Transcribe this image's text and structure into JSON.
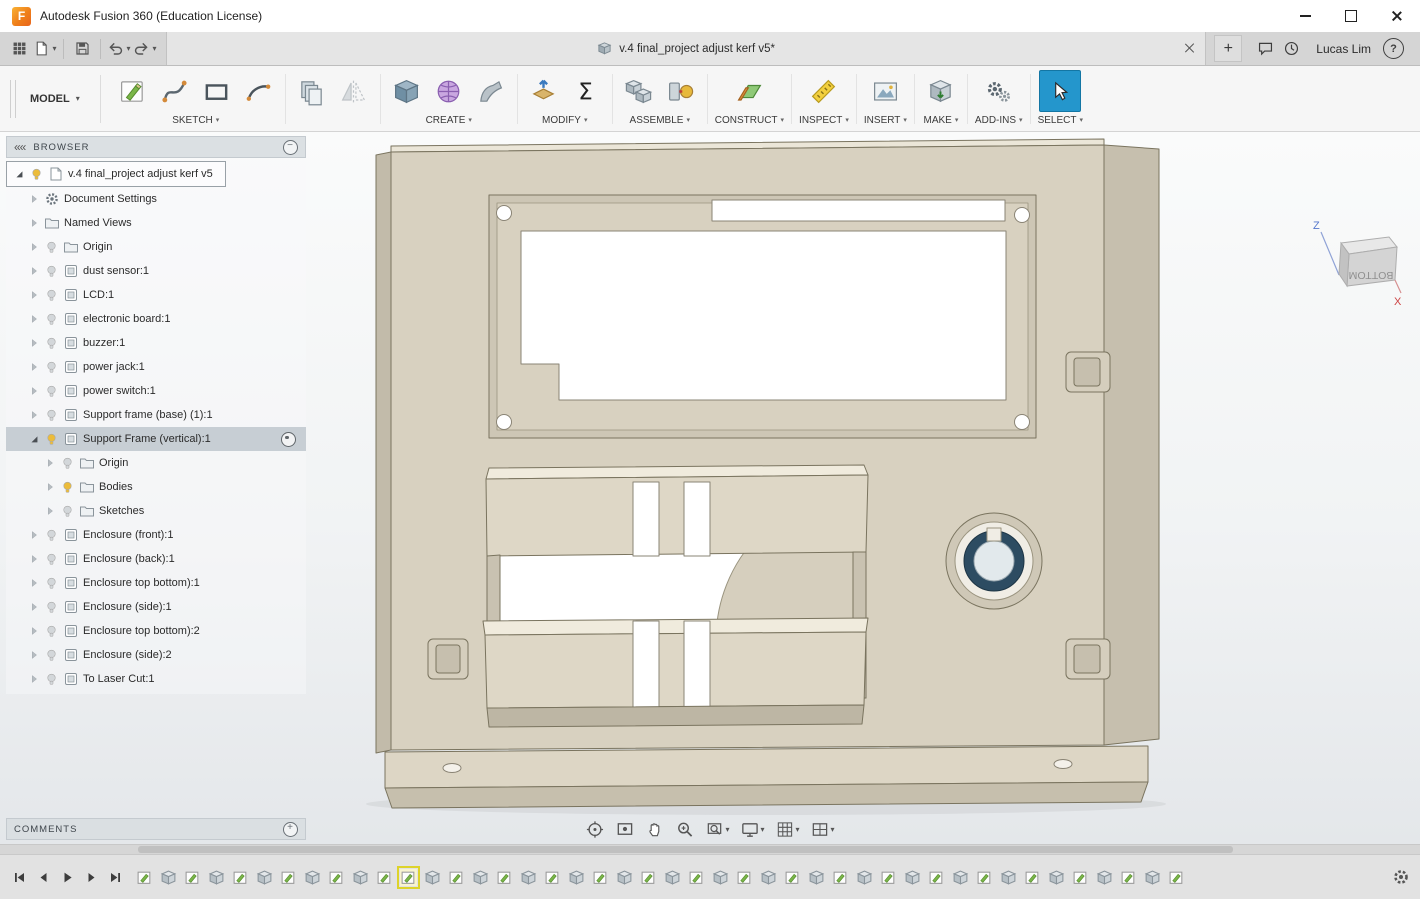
{
  "window": {
    "title": "Autodesk Fusion 360 (Education License)"
  },
  "quick_access": {
    "tab_title": "v.4 final_project adjust kerf v5*",
    "user_name": "Lucas Lim"
  },
  "ribbon": {
    "workspace_label": "MODEL",
    "groups": [
      {
        "label": "SKETCH",
        "icons": [
          "sketch",
          "spline",
          "rectangle",
          "arc"
        ]
      },
      {
        "label": "",
        "icons": [
          "pattern",
          "mirror"
        ]
      },
      {
        "label": "CREATE",
        "icons": [
          "box",
          "form",
          "sweep"
        ]
      },
      {
        "label": "MODIFY",
        "icons": [
          "presspull",
          "sigma"
        ]
      },
      {
        "label": "ASSEMBLE",
        "icons": [
          "assemble",
          "joint"
        ]
      },
      {
        "label": "CONSTRUCT",
        "icons": [
          "plane"
        ]
      },
      {
        "label": "INSPECT",
        "icons": [
          "measure"
        ]
      },
      {
        "label": "INSERT",
        "icons": [
          "canvas"
        ]
      },
      {
        "label": "MAKE",
        "icons": [
          "make"
        ]
      },
      {
        "label": "ADD-INS",
        "icons": [
          "addins"
        ]
      },
      {
        "label": "SELECT",
        "icons": [
          "select"
        ]
      }
    ]
  },
  "viewcube": {
    "face_label": "BOTTOM",
    "axis_z": "Z",
    "axis_x": "X"
  },
  "browser": {
    "header": "BROWSER",
    "rows": [
      {
        "label": "v.4 final_project adjust kerf v5",
        "depth": 0,
        "icon": "document",
        "bulb": "on",
        "arrow": "expanded",
        "root": true
      },
      {
        "label": "Document Settings",
        "depth": 1,
        "icon": "gear",
        "bulb": null,
        "arrow": "collapsed"
      },
      {
        "label": "Named Views",
        "depth": 1,
        "icon": "folder",
        "bulb": null,
        "arrow": "collapsed"
      },
      {
        "label": "Origin",
        "depth": 1,
        "icon": "folder",
        "bulb": "off",
        "arrow": "collapsed"
      },
      {
        "label": "dust sensor:1",
        "depth": 1,
        "icon": "component",
        "bulb": "off",
        "arrow": "collapsed"
      },
      {
        "label": "LCD:1",
        "depth": 1,
        "icon": "component",
        "bulb": "off",
        "arrow": "collapsed"
      },
      {
        "label": "electronic board:1",
        "depth": 1,
        "icon": "component",
        "bulb": "off",
        "arrow": "collapsed"
      },
      {
        "label": "buzzer:1",
        "depth": 1,
        "icon": "component",
        "bulb": "off",
        "arrow": "collapsed"
      },
      {
        "label": "power jack:1",
        "depth": 1,
        "icon": "component",
        "bulb": "off",
        "arrow": "collapsed"
      },
      {
        "label": "power switch:1",
        "depth": 1,
        "icon": "component",
        "bulb": "off",
        "arrow": "collapsed"
      },
      {
        "label": "Support frame (base) (1):1",
        "depth": 1,
        "icon": "component",
        "bulb": "off",
        "arrow": "collapsed"
      },
      {
        "label": "Support Frame (vertical):1",
        "depth": 1,
        "icon": "component",
        "bulb": "on",
        "arrow": "expanded",
        "selected": true,
        "activate": true
      },
      {
        "label": "Origin",
        "depth": 2,
        "icon": "folder",
        "bulb": "off",
        "arrow": "collapsed"
      },
      {
        "label": "Bodies",
        "depth": 2,
        "icon": "folder",
        "bulb": "on",
        "arrow": "collapsed"
      },
      {
        "label": "Sketches",
        "depth": 2,
        "icon": "folder",
        "bulb": "off",
        "arrow": "collapsed"
      },
      {
        "label": "Enclosure (front):1",
        "depth": 1,
        "icon": "component",
        "bulb": "off",
        "arrow": "collapsed"
      },
      {
        "label": "Enclosure (back):1",
        "depth": 1,
        "icon": "component",
        "bulb": "off",
        "arrow": "collapsed"
      },
      {
        "label": "Enclosure top bottom):1",
        "depth": 1,
        "icon": "component",
        "bulb": "off",
        "arrow": "collapsed"
      },
      {
        "label": "Enclosure (side):1",
        "depth": 1,
        "icon": "component",
        "bulb": "off",
        "arrow": "collapsed"
      },
      {
        "label": "Enclosure top bottom):2",
        "depth": 1,
        "icon": "component",
        "bulb": "off",
        "arrow": "collapsed"
      },
      {
        "label": "Enclosure (side):2",
        "depth": 1,
        "icon": "component",
        "bulb": "off",
        "arrow": "collapsed"
      },
      {
        "label": "To Laser Cut:1",
        "depth": 1,
        "icon": "component",
        "bulb": "off",
        "arrow": "collapsed"
      }
    ]
  },
  "comments": {
    "header": "COMMENTS"
  },
  "navbar": {
    "items": [
      {
        "icon": "orbit",
        "caret": false,
        "name": "orbit"
      },
      {
        "icon": "lookat",
        "caret": false,
        "name": "look-at"
      },
      {
        "icon": "pan",
        "caret": false,
        "name": "pan"
      },
      {
        "icon": "zoom",
        "caret": false,
        "name": "zoom"
      },
      {
        "icon": "fit",
        "caret": true,
        "name": "fit"
      },
      {
        "icon": "display",
        "caret": true,
        "name": "display-settings"
      },
      {
        "icon": "grid",
        "caret": true,
        "name": "grid-and-snaps"
      },
      {
        "icon": "viewports",
        "caret": true,
        "name": "viewports"
      }
    ]
  },
  "timeline": {
    "controls": [
      "skipstart",
      "stepback",
      "play",
      "stepfwd",
      "skipend"
    ],
    "highlight_index": 11,
    "icons": [
      "sketch",
      "cube",
      "sketch",
      "cube",
      "sketch",
      "cube",
      "sketch",
      "cube",
      "sketch",
      "cube",
      "sketch",
      "sketch",
      "cube",
      "sketch",
      "cube",
      "sketch",
      "cube",
      "sketch",
      "cube",
      "sketch",
      "cube",
      "sketch",
      "cube",
      "sketch",
      "cube",
      "sketch",
      "cube",
      "sketch",
      "cube",
      "sketch",
      "cube",
      "sketch",
      "cube",
      "sketch",
      "cube",
      "sketch",
      "cube",
      "sketch",
      "cube",
      "sketch",
      "cube",
      "sketch",
      "cube",
      "sketch"
    ]
  }
}
